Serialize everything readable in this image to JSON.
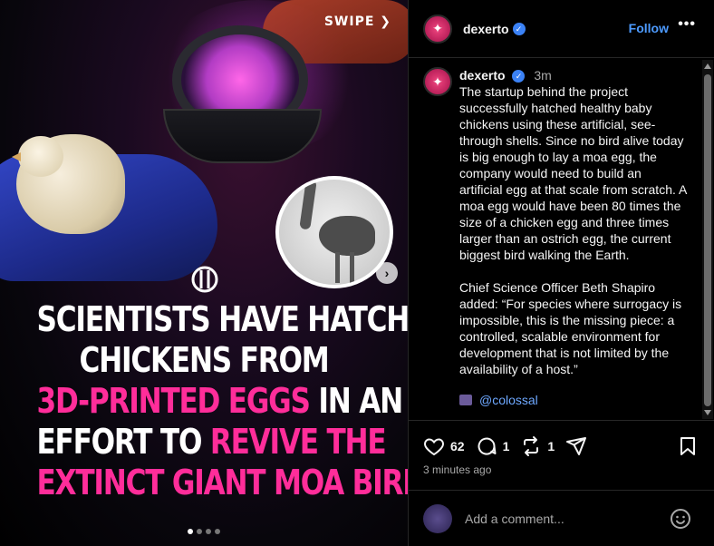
{
  "media": {
    "swipe_label": "SWIPE",
    "headline_lines": [
      [
        {
          "text": "SCIENTISTS HAVE HATCHED",
          "color": "white"
        }
      ],
      [
        {
          "text": "CHICKENS FROM",
          "color": "white"
        }
      ],
      [
        {
          "text": "3D-PRINTED EGGS",
          "color": "pink"
        },
        {
          "text": " IN AN",
          "color": "white"
        }
      ],
      [
        {
          "text": "EFFORT TO ",
          "color": "white"
        },
        {
          "text": "REVIVE THE",
          "color": "pink"
        }
      ],
      [
        {
          "text": "EXTINCT GIANT MOA BIRD",
          "color": "pink"
        }
      ]
    ],
    "carousel_count": 4,
    "carousel_active": 0,
    "accent_pink": "#ff2d9a"
  },
  "header": {
    "username": "dexerto",
    "follow_label": "Follow",
    "more_label": "•••"
  },
  "caption": {
    "username": "dexerto",
    "time": "3m",
    "paragraph1": "The startup behind the project successfully hatched healthy baby chickens using these artificial, see-through shells. Since no bird alive today is big enough to lay a moa egg, the company would need to build an artificial egg at that scale from scratch. A moa egg would have been 80 times the size of a chicken egg and three times larger than an ostrich egg, the current biggest bird walking the Earth.",
    "paragraph2": "Chief Science Officer Beth Shapiro added: “For species where surrogacy is impossible, this is the missing piece: a controlled, scalable environment for development that is not limited by the availability of a host.”",
    "mention": "@colossal"
  },
  "actions": {
    "likes": "62",
    "comments": "1",
    "reposts": "1",
    "posted_ago": "3 minutes ago"
  },
  "add_comment": {
    "placeholder": "Add a comment..."
  }
}
